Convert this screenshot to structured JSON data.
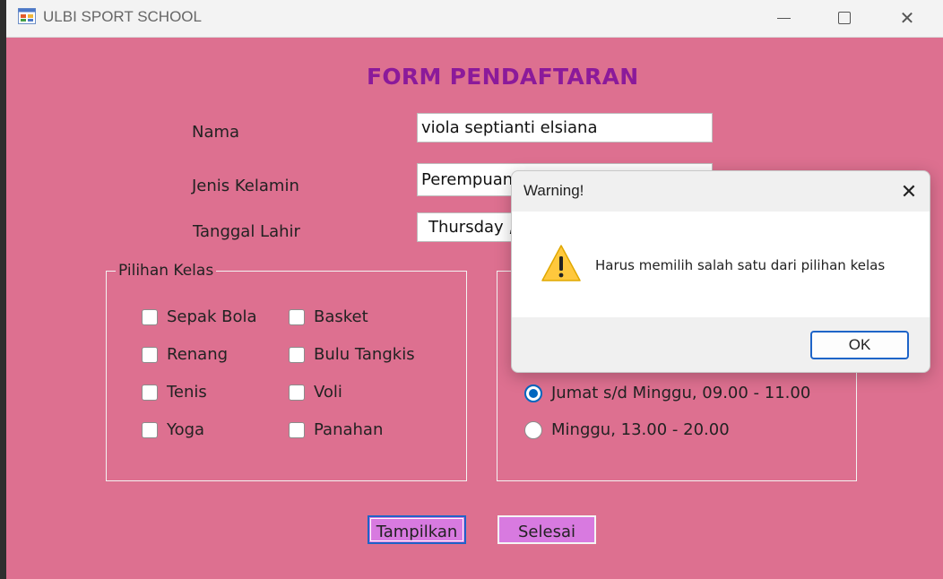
{
  "window": {
    "title": "ULBI SPORT SCHOOL",
    "controls": {
      "minimize": "minimize-icon",
      "maximize": "maximize-icon",
      "close": "close-icon"
    }
  },
  "form": {
    "heading": "FORM PENDAFTARAN",
    "nama_label": "Nama",
    "nama_value": "viola septianti elsiana",
    "jenis_kelamin_label": "Jenis Kelamin",
    "jenis_kelamin_value": "Perempuan",
    "tanggal_lahir_label": "Tanggal Lahir",
    "tanggal_lahir_value": "Thursday  ,",
    "pilihan_kelas": {
      "title": "Pilihan Kelas",
      "options": [
        "Sepak Bola",
        "Basket",
        "Renang",
        "Bulu Tangkis",
        "Tenis",
        "Voli",
        "Yoga",
        "Panahan"
      ]
    },
    "jadwal": {
      "options": [
        {
          "label": "Jumat s/d Minggu, 09.00 - 11.00",
          "selected": true
        },
        {
          "label": "Minggu, 13.00 - 20.00",
          "selected": false
        }
      ]
    },
    "buttons": {
      "tampilkan": "Tampilkan",
      "selesai": "Selesai"
    }
  },
  "dialog": {
    "title": "Warning!",
    "message": "Harus memilih salah satu dari pilihan kelas",
    "ok_label": "OK",
    "icon": "warning-icon"
  },
  "colors": {
    "form_background": "#dd7090",
    "heading": "#8b1a9a",
    "button_fill": "#d87ae0",
    "accent": "#0067c0"
  }
}
